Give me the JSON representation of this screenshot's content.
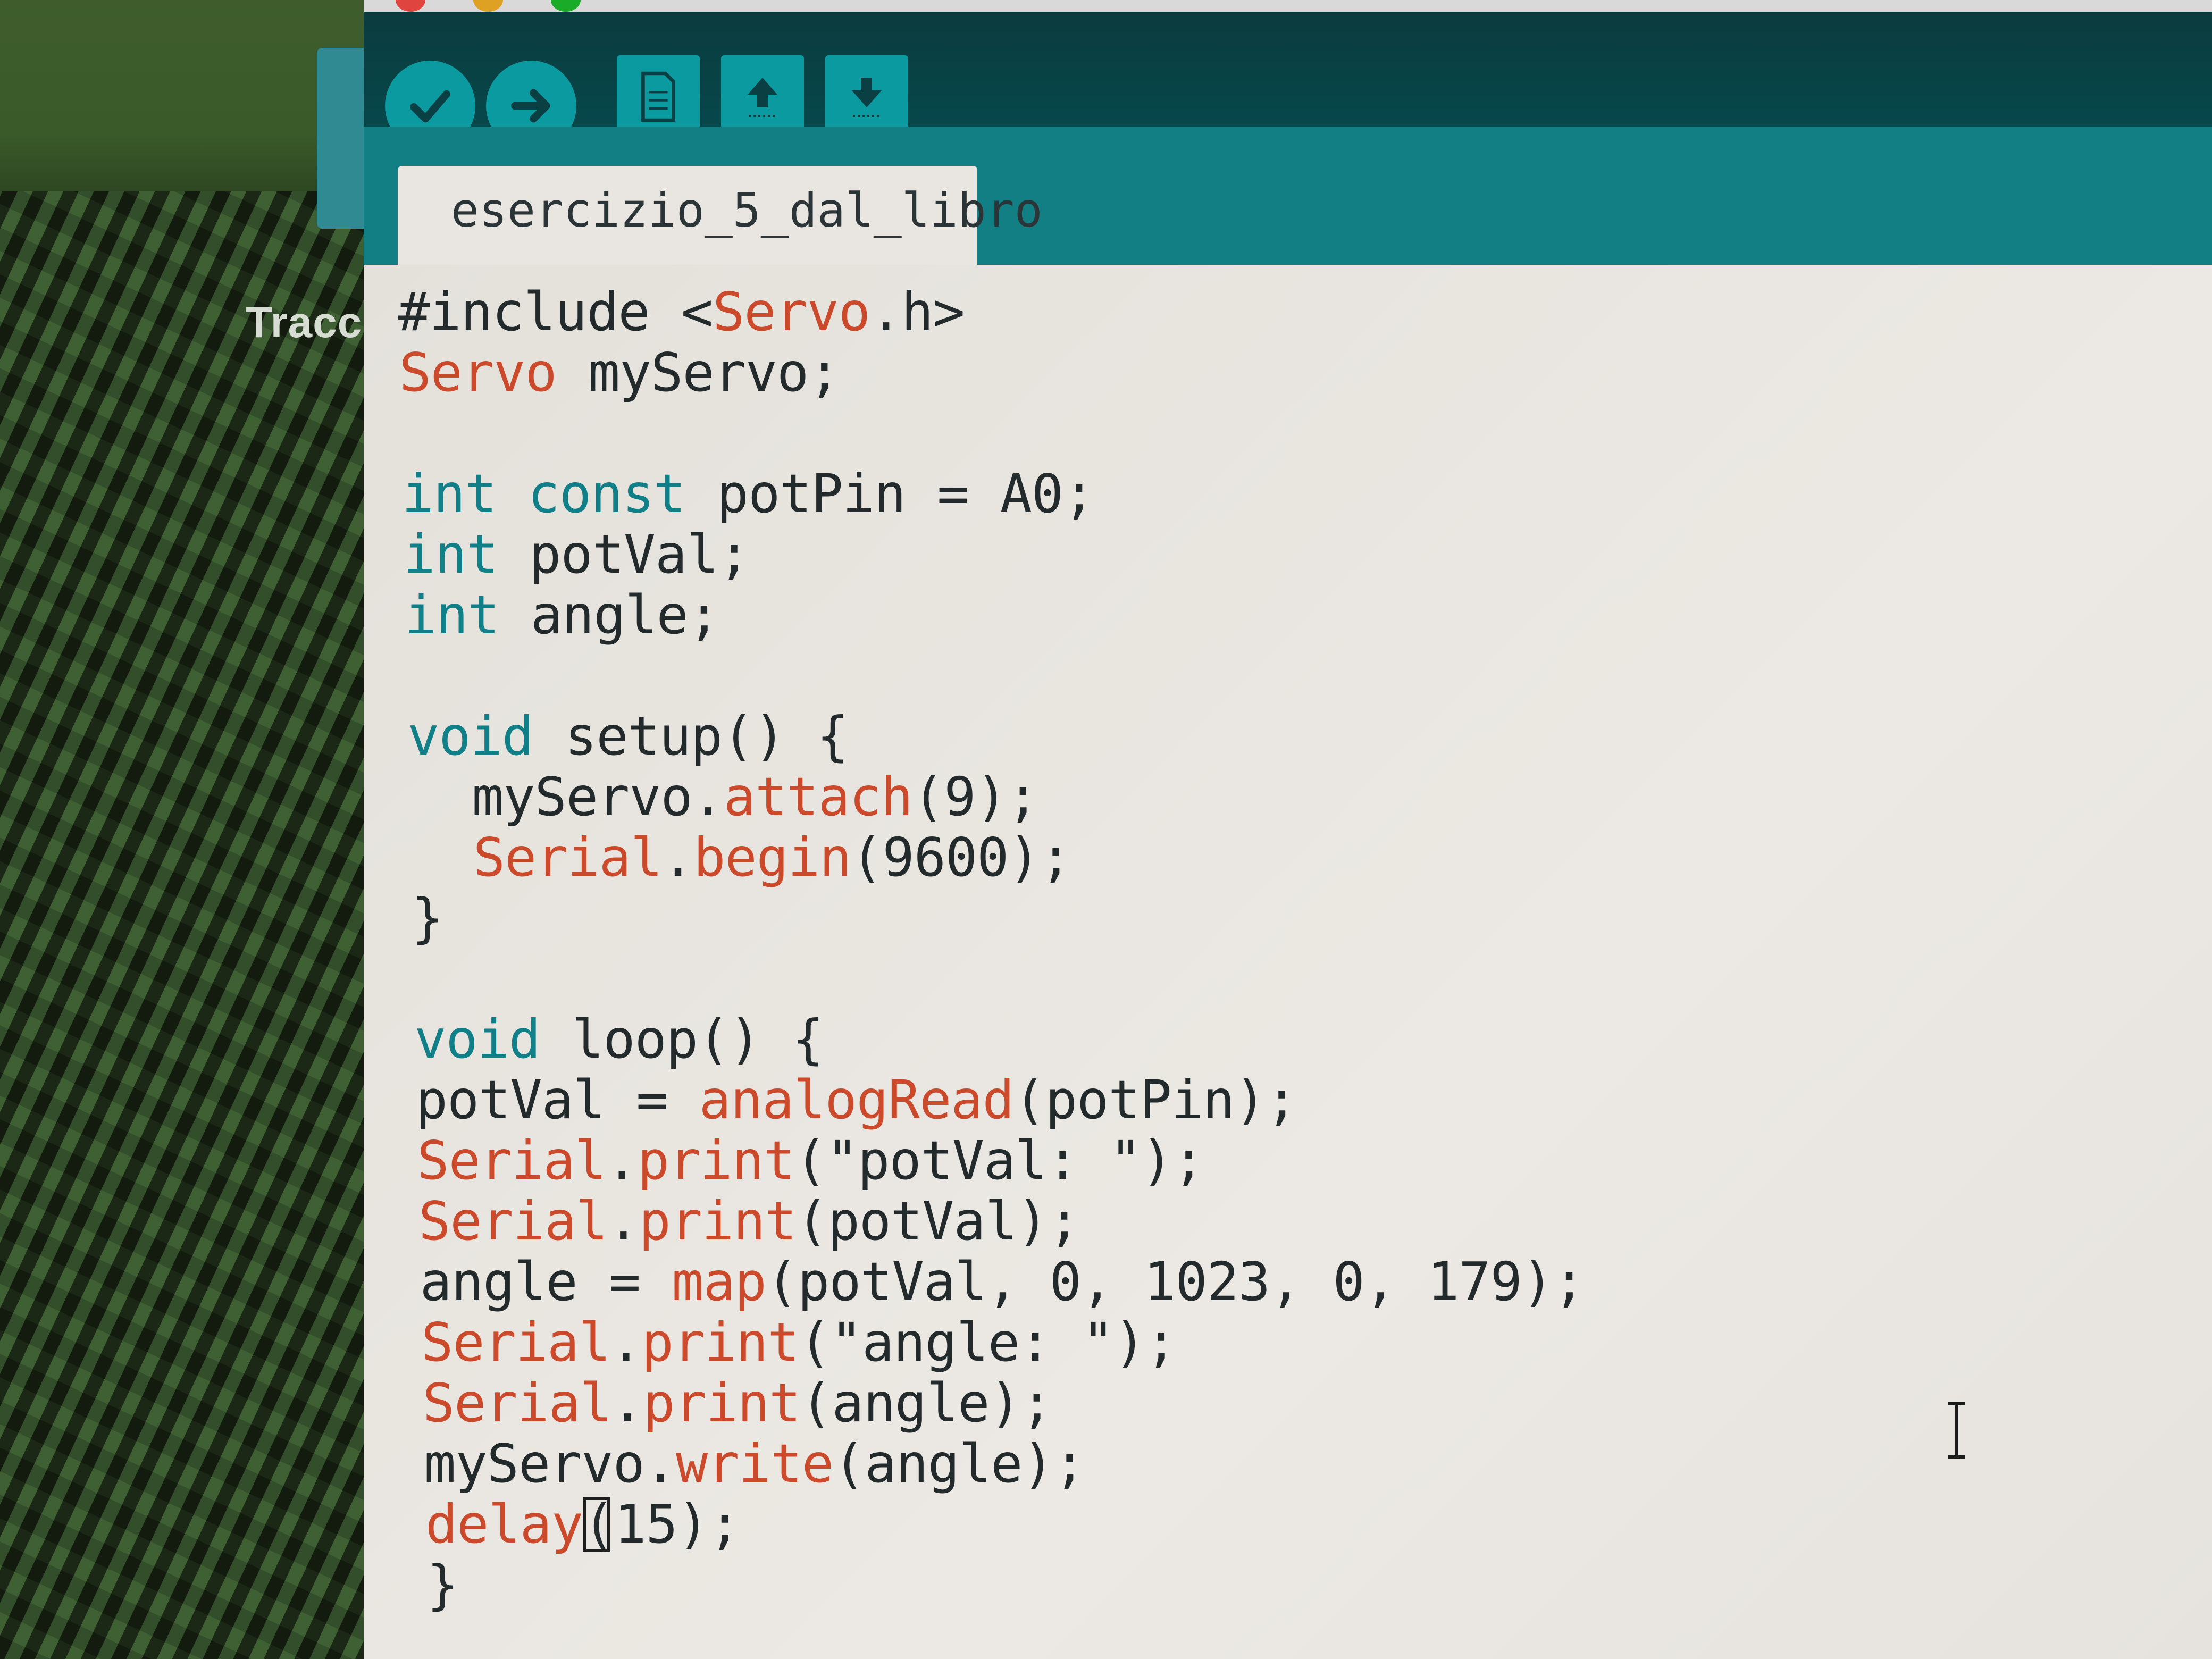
{
  "sidebar_label": "Tracc",
  "window": {
    "tab_name": "esercizio_5_dal_libro"
  },
  "toolbar": {
    "buttons": [
      {
        "icon": "checkmark-icon",
        "name": "verify"
      },
      {
        "icon": "arrow-right-icon",
        "name": "upload"
      },
      {
        "icon": "document-icon",
        "name": "new"
      },
      {
        "icon": "arrow-up-icon",
        "name": "open"
      },
      {
        "icon": "arrow-down-icon",
        "name": "save"
      }
    ]
  },
  "colors": {
    "toolbar": "#06494c",
    "tabbar": "#127f84",
    "button": "#0c9aa1",
    "keyword": "#107f87",
    "function": "#cc4a2c",
    "text": "#232a2c",
    "editor_bg": "#e9e6e1"
  },
  "code": [
    {
      "segments": [
        {
          "t": "#include <",
          "c": "plain"
        },
        {
          "t": "Servo",
          "c": "fn"
        },
        {
          "t": ".h>",
          "c": "plain"
        }
      ]
    },
    {
      "segments": [
        {
          "t": "Servo",
          "c": "fn"
        },
        {
          "t": " myServo;",
          "c": "plain"
        }
      ]
    },
    {
      "segments": []
    },
    {
      "segments": [
        {
          "t": "int const",
          "c": "kw"
        },
        {
          "t": " potPin = A0;",
          "c": "plain"
        }
      ]
    },
    {
      "segments": [
        {
          "t": "int",
          "c": "kw"
        },
        {
          "t": " potVal;",
          "c": "plain"
        }
      ]
    },
    {
      "segments": [
        {
          "t": "int",
          "c": "kw"
        },
        {
          "t": " angle;",
          "c": "plain"
        }
      ]
    },
    {
      "segments": []
    },
    {
      "segments": [
        {
          "t": "void",
          "c": "kw"
        },
        {
          "t": " setup() {",
          "c": "plain"
        }
      ]
    },
    {
      "segments": [
        {
          "t": "  myServo.",
          "c": "plain"
        },
        {
          "t": "attach",
          "c": "fn"
        },
        {
          "t": "(9);",
          "c": "plain"
        }
      ]
    },
    {
      "segments": [
        {
          "t": "  ",
          "c": "plain"
        },
        {
          "t": "Serial",
          "c": "fn"
        },
        {
          "t": ".",
          "c": "plain"
        },
        {
          "t": "begin",
          "c": "fn"
        },
        {
          "t": "(9600);",
          "c": "plain"
        }
      ]
    },
    {
      "segments": [
        {
          "t": "}",
          "c": "plain"
        }
      ]
    },
    {
      "segments": []
    },
    {
      "segments": [
        {
          "t": "void",
          "c": "kw"
        },
        {
          "t": " loop() {",
          "c": "plain"
        }
      ]
    },
    {
      "segments": [
        {
          "t": "potVal = ",
          "c": "plain"
        },
        {
          "t": "analogRead",
          "c": "fn"
        },
        {
          "t": "(potPin);",
          "c": "plain"
        }
      ]
    },
    {
      "segments": [
        {
          "t": "Serial",
          "c": "fn"
        },
        {
          "t": ".",
          "c": "plain"
        },
        {
          "t": "print",
          "c": "fn"
        },
        {
          "t": "(\"potVal: \");",
          "c": "plain"
        }
      ]
    },
    {
      "segments": [
        {
          "t": "Serial",
          "c": "fn"
        },
        {
          "t": ".",
          "c": "plain"
        },
        {
          "t": "print",
          "c": "fn"
        },
        {
          "t": "(potVal);",
          "c": "plain"
        }
      ]
    },
    {
      "segments": [
        {
          "t": "angle = ",
          "c": "plain"
        },
        {
          "t": "map",
          "c": "fn"
        },
        {
          "t": "(potVal, 0, 1023, 0, 179);",
          "c": "plain"
        }
      ]
    },
    {
      "segments": [
        {
          "t": "Serial",
          "c": "fn"
        },
        {
          "t": ".",
          "c": "plain"
        },
        {
          "t": "print",
          "c": "fn"
        },
        {
          "t": "(\"angle: \");",
          "c": "plain"
        }
      ]
    },
    {
      "segments": [
        {
          "t": "Serial",
          "c": "fn"
        },
        {
          "t": ".",
          "c": "plain"
        },
        {
          "t": "print",
          "c": "fn"
        },
        {
          "t": "(angle);",
          "c": "plain"
        }
      ]
    },
    {
      "segments": [
        {
          "t": "myServo.",
          "c": "plain"
        },
        {
          "t": "write",
          "c": "fn"
        },
        {
          "t": "(angle);",
          "c": "plain"
        }
      ]
    },
    {
      "segments": [
        {
          "t": "delay",
          "c": "fn"
        },
        {
          "t": "CURSOR",
          "c": "cursor"
        },
        {
          "t": "(15);",
          "c": "plain"
        }
      ]
    },
    {
      "segments": [
        {
          "t": "}",
          "c": "plain"
        }
      ]
    }
  ]
}
